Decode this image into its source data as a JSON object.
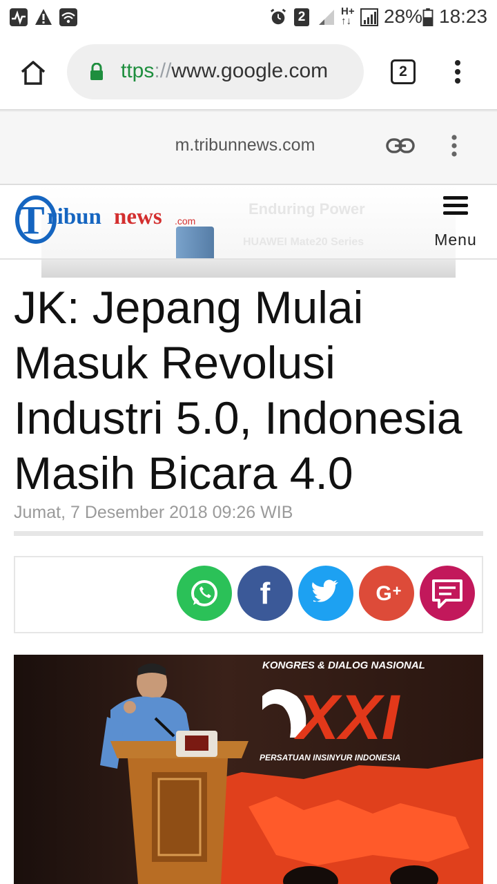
{
  "status_bar": {
    "sim_badge": "2",
    "network": "H+",
    "battery": "28%",
    "time": "18:23",
    "icons": [
      "activity-icon",
      "warning-icon",
      "wifi-icon",
      "alarm-icon",
      "sim-2-icon",
      "signal-icon",
      "data-arrows-icon",
      "battery-icon"
    ]
  },
  "browser": {
    "url_scheme": "ttps",
    "url_sep": "://",
    "url_host": "www.google.com",
    "tab_count": "2",
    "icons": [
      "home-icon",
      "lock-icon",
      "more-vert-icon"
    ]
  },
  "custom_tab": {
    "url": "m.tribunnews.com",
    "icons": [
      "link-icon",
      "more-vert-icon"
    ]
  },
  "site_header": {
    "logo_text": "Tribunnews.com",
    "menu_label": "Menu",
    "ad_line1": "Enduring Power",
    "ad_line2": "HUAWEI Mate20 Series"
  },
  "article": {
    "headline": "JK: Jepang Mulai Masuk Revolusi Industri 5.0, Indonesia Masih Bicara 4.0",
    "date": "Jumat, 7 Desember 2018 09:26 WIB",
    "share_buttons": [
      {
        "name": "whatsapp",
        "color": "#2bc158"
      },
      {
        "name": "facebook",
        "color": "#3b5998"
      },
      {
        "name": "twitter",
        "color": "#1da1f2"
      },
      {
        "name": "google-plus",
        "color": "#dd4b39"
      },
      {
        "name": "comment",
        "color": "#c2185b"
      }
    ],
    "photo_banner_line1": "KONGRES & DIALOG NASIONAL",
    "photo_banner_xxi": "XXI",
    "photo_banner_line2": "PERSATUAN INSINYUR INDONESIA"
  },
  "colors": {
    "brand_blue": "#1565c0",
    "brand_red": "#d32f2f",
    "secure_green": "#1e8e3e"
  }
}
